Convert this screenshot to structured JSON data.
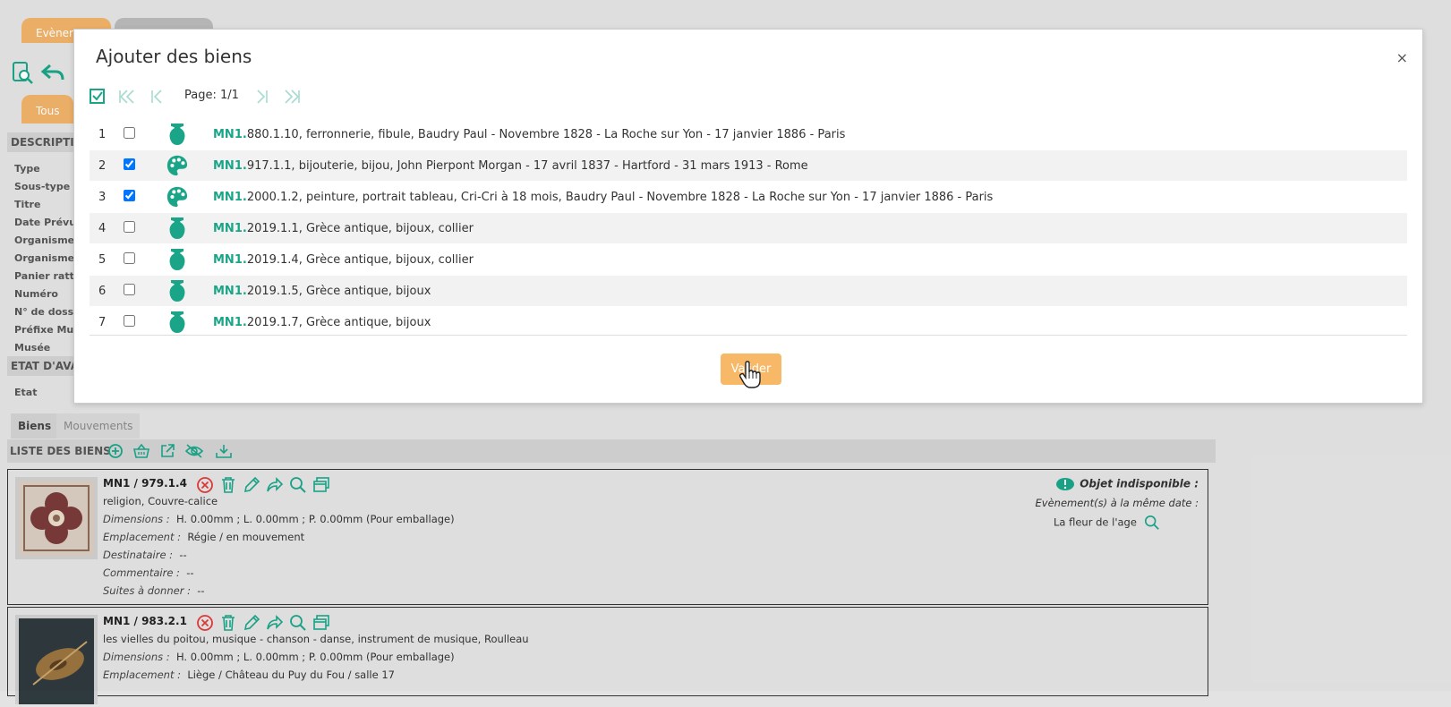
{
  "background": {
    "tabs": [
      {
        "label": "Evènem"
      },
      {
        "label": ""
      }
    ],
    "filter_tab": "Tous",
    "sections": [
      "DESCRIPTIO",
      "ETAT D'AVA"
    ],
    "fields": [
      "Type",
      "Sous-type",
      "Titre",
      "Date Prévue",
      "Organisme r",
      "Organisme c",
      "Panier ratta",
      "Numéro",
      "N° de dossie",
      "Préfixe Mus",
      "Musée"
    ],
    "etat_label": "Etat",
    "subtabs": [
      {
        "label": "Biens"
      },
      {
        "label": "Mouvements"
      }
    ],
    "list_title": "LISTE DES BIENS",
    "items": [
      {
        "ref": "MN1 / 979.1.4",
        "desc": "religion, Couvre-calice",
        "dimensions_label": "Dimensions :",
        "dimensions": "H. 0.00mm ; L. 0.00mm ; P. 0.00mm (Pour emballage)",
        "emplacement_label": "Emplacement :",
        "emplacement": "Régie / en mouvement",
        "destinataire_label": "Destinataire :",
        "destinataire": "--",
        "commentaire_label": "Commentaire :",
        "commentaire": "--",
        "suites_label": "Suites à donner :",
        "suites": "--",
        "unavailable_title": "Objet indisponible :",
        "unavailable_sub": "Evènement(s) à la même date :",
        "event": "La fleur de l'age"
      },
      {
        "ref": "MN1 / 983.2.1",
        "desc": "les vielles du poitou, musique - chanson - danse, instrument de musique, Roulleau",
        "dimensions_label": "Dimensions :",
        "dimensions": "H. 0.00mm ; L. 0.00mm ; P. 0.00mm (Pour emballage)",
        "emplacement_label": "Emplacement :",
        "emplacement": "Liège / Château du Puy du Fou / salle 17"
      }
    ]
  },
  "modal": {
    "title": "Ajouter des biens",
    "close": "×",
    "page_label": "Page: 1/1",
    "rows": [
      {
        "num": "1",
        "checked": false,
        "icon": "vase-icon",
        "prefix": "MN1.",
        "text": "880.1.10, ferronnerie, fibule, Baudry Paul - Novembre 1828 - La Roche sur Yon - 17 janvier 1886 - Paris"
      },
      {
        "num": "2",
        "checked": true,
        "icon": "palette-icon",
        "prefix": "MN1.",
        "text": "917.1.1, bijouterie, bijou, John Pierpont Morgan - 17 avril 1837 - Hartford - 31 mars 1913 - Rome"
      },
      {
        "num": "3",
        "checked": true,
        "icon": "palette-icon",
        "prefix": "MN1.",
        "text": "2000.1.2, peinture, portrait tableau, Cri-Cri à 18 mois, Baudry Paul - Novembre 1828 - La Roche sur Yon - 17 janvier 1886 - Paris"
      },
      {
        "num": "4",
        "checked": false,
        "icon": "vase-icon",
        "prefix": "MN1.",
        "text": "2019.1.1, Grèce antique, bijoux, collier"
      },
      {
        "num": "5",
        "checked": false,
        "icon": "vase-icon",
        "prefix": "MN1.",
        "text": "2019.1.4, Grèce antique, bijoux, collier"
      },
      {
        "num": "6",
        "checked": false,
        "icon": "vase-icon",
        "prefix": "MN1.",
        "text": "2019.1.5, Grèce antique, bijoux"
      },
      {
        "num": "7",
        "checked": false,
        "icon": "vase-icon",
        "prefix": "MN1.",
        "text": "2019.1.7, Grèce antique, bijoux"
      }
    ],
    "submit_label": "Valider"
  },
  "colors": {
    "accent": "#1aa589",
    "orange": "#f0b26a",
    "danger": "#e03a3a"
  }
}
